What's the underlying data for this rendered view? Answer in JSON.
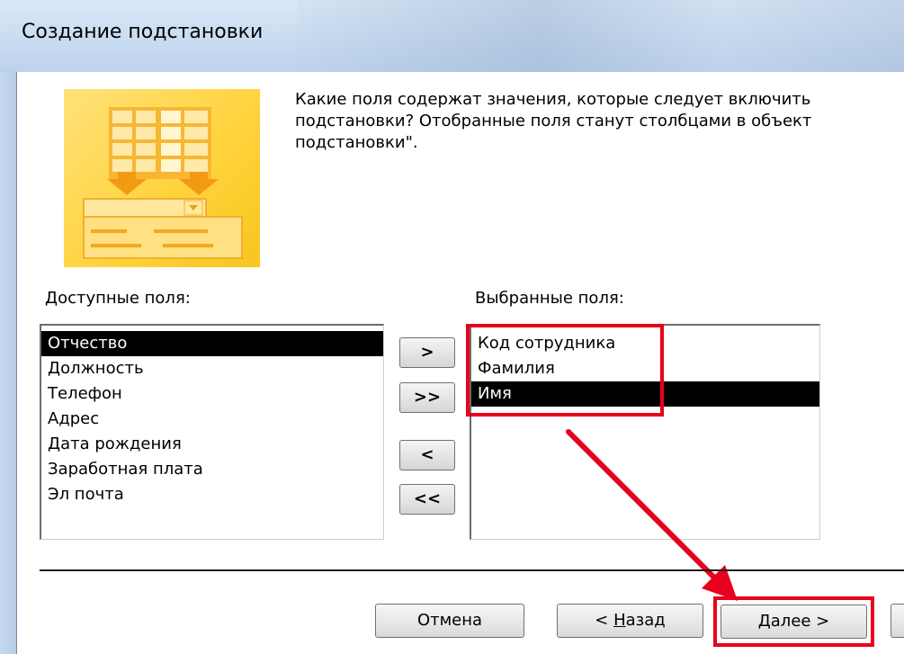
{
  "window": {
    "title": "Создание подстановки"
  },
  "prompt": {
    "line1": "Какие поля содержат значения, которые следует включить",
    "line2": "подстановки? Отобранные поля станут столбцами в объект",
    "line3": "подстановки\"."
  },
  "available": {
    "label": "Доступные поля:",
    "items": [
      "Отчество",
      "Должность",
      "Телефон",
      "Адрес",
      "Дата рождения",
      "Заработная плата",
      "Эл почта"
    ],
    "selected_index": 0
  },
  "selected": {
    "label": "Выбранные поля:",
    "items": [
      "Код сотрудника",
      "Фамилия",
      "Имя"
    ],
    "selected_index": 2
  },
  "transfer_buttons": {
    "add_one": ">",
    "add_all": ">>",
    "remove_one": "<",
    "remove_all": "<<"
  },
  "footer": {
    "cancel": "Отмена",
    "back_prefix": "< ",
    "back_mnemonic": "Н",
    "back_rest": "азад",
    "next_mnemonic": "Д",
    "next_rest": "алее >"
  },
  "colors": {
    "highlight": "#e8001c",
    "arrow": "#e8001c",
    "wizard_image": "#ffd23a",
    "selection": "#000000"
  },
  "icons": {
    "wizard_image": "lookup-wizard-illustration",
    "annotation_arrow": "red-arrow-annotation"
  }
}
